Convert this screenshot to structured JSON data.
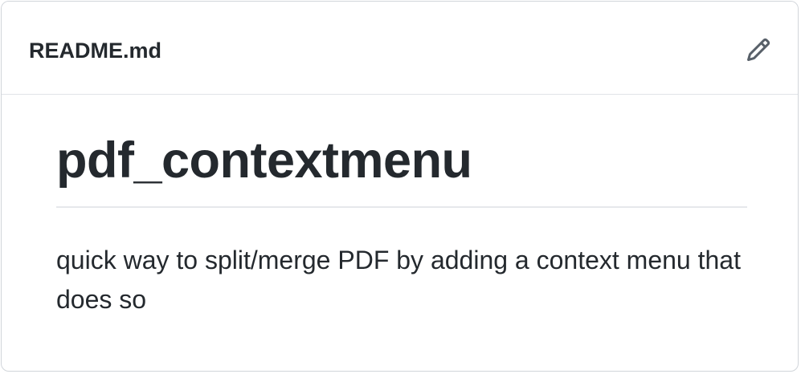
{
  "header": {
    "file_name": "README.md",
    "edit_icon": "pencil-icon"
  },
  "content": {
    "title": "pdf_contextmenu",
    "description": "quick way to split/merge PDF by adding a context menu that does so"
  },
  "colors": {
    "text": "#24292e",
    "icon": "#586069",
    "border": "#d1d5da",
    "divider": "#e6e8eb"
  }
}
